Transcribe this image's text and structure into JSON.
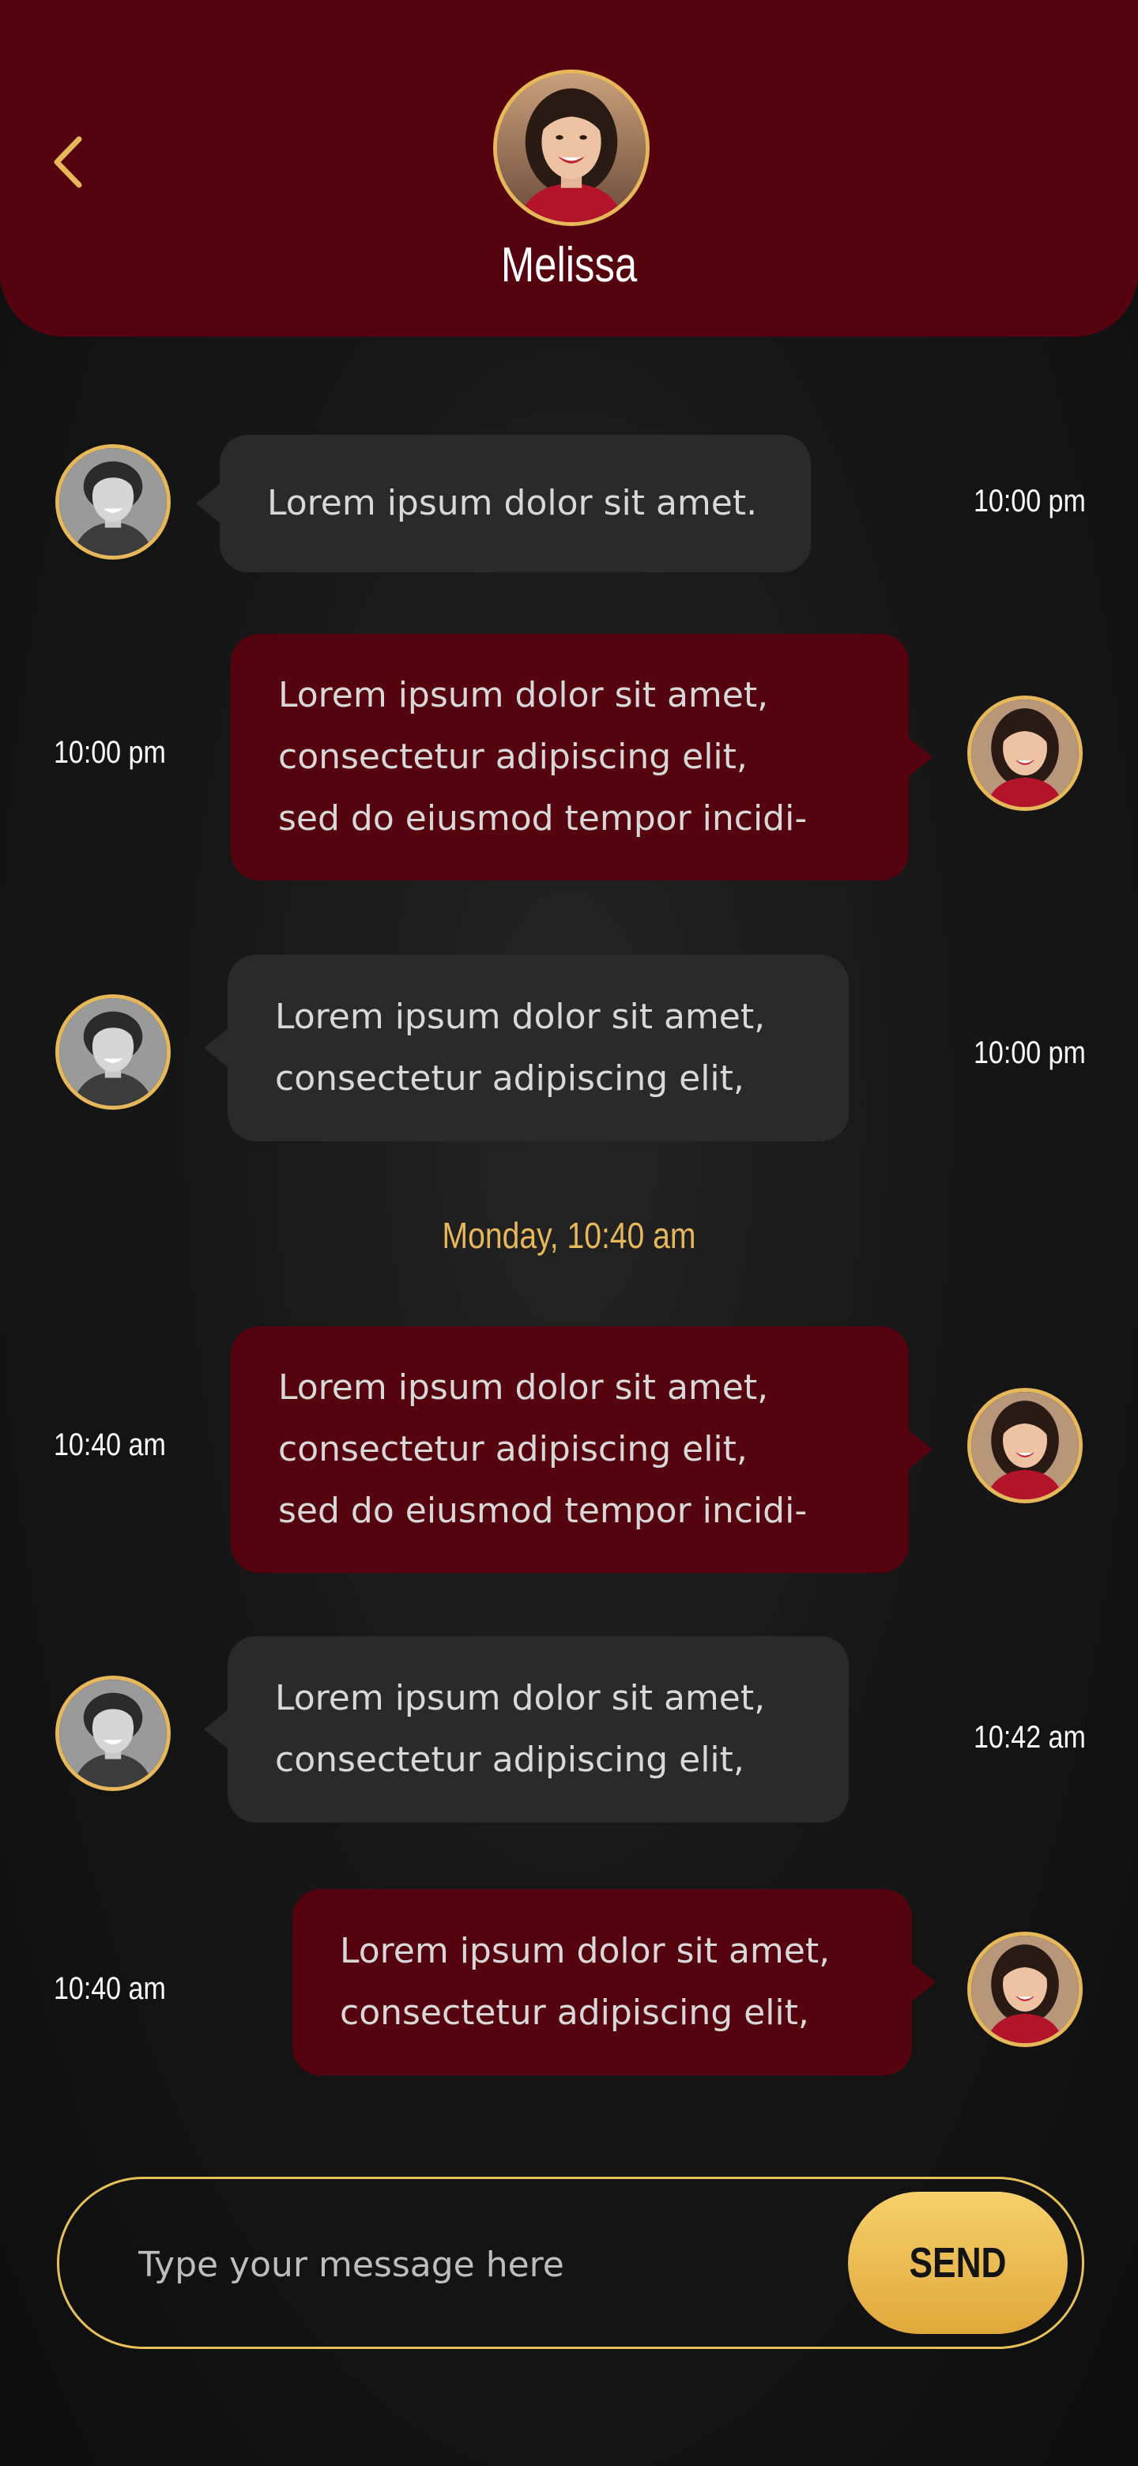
{
  "header": {
    "name": "Melissa",
    "back_icon": "chevron-left-icon",
    "avatar": "melissa-avatar",
    "background": "#55030f",
    "accent": "#e6b85a"
  },
  "messages": [
    {
      "from": "contact",
      "lines": [
        "Lorem ipsum dolor sit amet."
      ],
      "time": "10:00 pm"
    },
    {
      "from": "me",
      "lines": [
        "Lorem ipsum dolor sit amet,",
        "consectetur adipiscing elit,",
        "sed do eiusmod tempor incidi-"
      ],
      "time": "10:00 pm"
    },
    {
      "from": "contact",
      "lines": [
        "Lorem ipsum dolor sit amet,",
        "consectetur adipiscing elit,"
      ],
      "time": "10:00 pm"
    },
    {
      "from": "me",
      "lines": [
        "Lorem ipsum dolor sit amet,",
        "consectetur adipiscing elit,",
        "sed do eiusmod tempor incidi-"
      ],
      "time": "10:40 am"
    },
    {
      "from": "contact",
      "lines": [
        "Lorem ipsum dolor sit amet,",
        "consectetur adipiscing elit,"
      ],
      "time": "10:42 am"
    },
    {
      "from": "me",
      "lines": [
        "Lorem ipsum dolor sit amet,",
        "consectetur adipiscing elit,"
      ],
      "time": "10:40 am"
    }
  ],
  "date_divider": "Monday, 10:40 am",
  "composer": {
    "placeholder": "Type your message here",
    "send_label": "SEND"
  },
  "colors": {
    "incoming_bubble": "#2a2a2a",
    "outgoing_bubble": "#55030f",
    "gold": "#e6b85a"
  }
}
